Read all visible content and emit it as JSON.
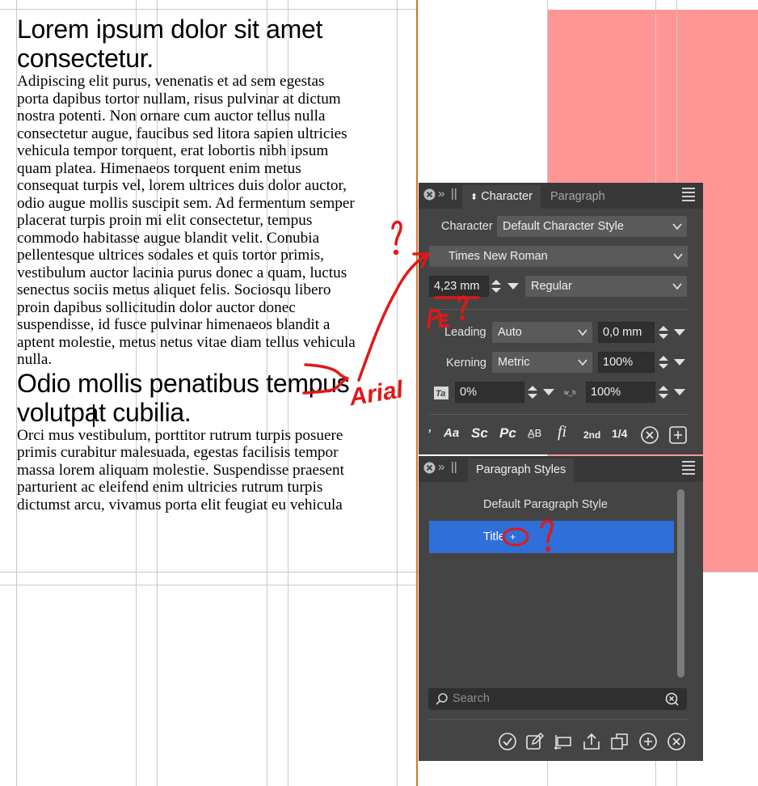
{
  "document": {
    "heading1": [
      "Lorem ipsum dolor sit amet",
      "consectetur."
    ],
    "paragraph1": [
      "Adipiscing elit purus, venenatis et ad sem egestas",
      "porta dapibus tortor nullam, risus pulvinar at dictum",
      "nostra potenti. Non ornare cum auctor tellus nulla",
      "consectetur augue, faucibus sed litora sapien ultricies",
      "vehicula tempor torquent, erat lobortis nibh ipsum",
      "quam platea. Himenaeos torquent enim metus",
      "consequat turpis vel, lorem ultrices duis dolor auctor,",
      "odio augue mollis suscipit sem. Ad fermentum semper",
      "placerat turpis proin mi elit consectetur, tempus",
      "commodo habitasse augue blandit velit. Conubia",
      "pellentesque ultrices sodales et quis tortor primis,",
      "vestibulum auctor lacinia purus donec a quam, luctus",
      "senectus sociis metus aliquet felis. Sociosqu libero",
      "proin dapibus sollicitudin dolor auctor donec",
      "suspendisse, id fusce pulvinar himenaeos blandit a",
      "aptent molestie, metus netus vitae diam tellus vehicula",
      "nulla."
    ],
    "heading2": [
      "Odio mollis penatibus tempus",
      "volutpat cubilia."
    ],
    "paragraph2": [
      "Orci mus vestibulum, porttitor rutrum turpis posuere",
      "primis curabitur malesuada, egestas facilisis tempor",
      "massa lorem aliquam molestie. Suspendisse praesent",
      "parturient ac eleifend enim ultricies rutrum turpis",
      "dictumst arcu, vivamus porta elit feugiat eu vehicula"
    ]
  },
  "character_panel": {
    "tab_active": "Character",
    "tab_inactive": "Paragraph",
    "character_label": "Character",
    "character_style": "Default Character Style",
    "font_family": "Times New Roman",
    "font_size": "4,23 mm",
    "font_style": "Regular",
    "leading_label": "Leading",
    "leading_value": "Auto",
    "leading_offset": "0,0 mm",
    "kerning_label": "Kerning",
    "kerning_value": "Metric",
    "kerning_percent": "100%",
    "tracking_value": "0%",
    "scale_value": "100%",
    "typo_buttons": [
      "Aa",
      "Sc",
      "Pc",
      "A̲B",
      "fi",
      "2nd",
      "1/4"
    ]
  },
  "paragraph_styles_panel": {
    "tab": "Paragraph Styles",
    "items": [
      "Default Paragraph Style",
      "Title",
      "+"
    ],
    "search_placeholder": "Search"
  },
  "annotations": {
    "text": "Arial"
  },
  "colors": {
    "panel_bg": "#444444",
    "selected": "#2e6fd9",
    "pink": "#ff9696",
    "spine": "#d4782a",
    "annotation": "#e01818"
  }
}
